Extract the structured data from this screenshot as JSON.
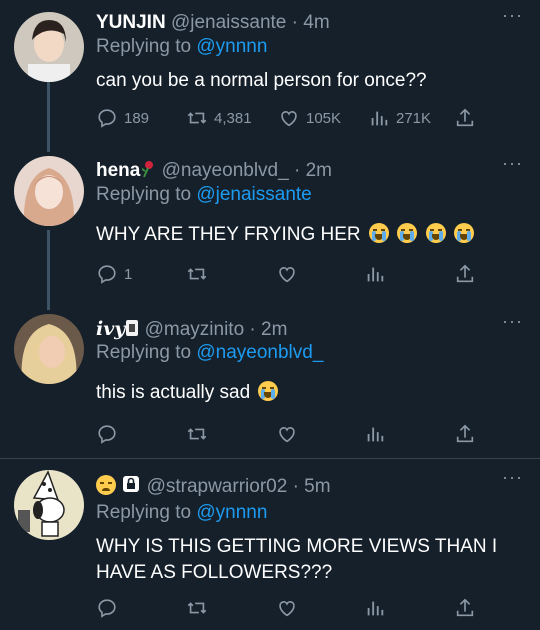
{
  "tweets": [
    {
      "display_name": "YUNJIN",
      "handle": "@jenaissante",
      "time": "· 4m",
      "replying_prefix": "Replying to ",
      "replying_to": "@ynnnn",
      "text": "can you be a normal person for once??",
      "stats": {
        "replies": "189",
        "retweets": "4,381",
        "likes": "105K",
        "views": "271K"
      }
    },
    {
      "display_name": "hena",
      "handle": "@nayeonblvd_",
      "time": "· 2m",
      "replying_prefix": "Replying to ",
      "replying_to": "@jenaissante",
      "text": "WHY ARE THEY FRYING HER",
      "stats": {
        "replies": "1",
        "retweets": "",
        "likes": "",
        "views": ""
      }
    },
    {
      "display_name": "ivy",
      "handle": "@mayzinito",
      "time": "· 2m",
      "replying_prefix": "Replying to ",
      "replying_to": "@nayeonblvd_",
      "text": "this is actually sad",
      "stats": {
        "replies": "",
        "retweets": "",
        "likes": "",
        "views": ""
      }
    },
    {
      "display_name": "",
      "handle": "@strapwarrior02",
      "time": "· 5m",
      "replying_prefix": "Replying to ",
      "replying_to": "@ynnnn",
      "text": "WHY IS THIS GETTING MORE VIEWS THAN I HAVE AS FOLLOWERS???",
      "stats": {
        "replies": "",
        "retweets": "",
        "likes": "",
        "views": ""
      }
    }
  ],
  "icons": [
    "reply-icon",
    "retweet-icon",
    "like-icon",
    "views-icon",
    "share-icon",
    "more-icon",
    "lock-icon"
  ],
  "colors": {
    "background": "#15202b",
    "muted": "#8b98a5",
    "accent": "#1d9bf0",
    "divider": "#38444d"
  }
}
